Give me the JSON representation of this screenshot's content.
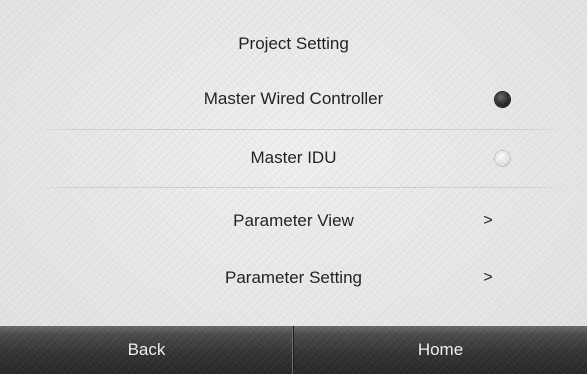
{
  "screen": {
    "title": "Project Setting"
  },
  "rows": [
    {
      "label": "Master Wired Controller",
      "control": "radio",
      "selected": true
    },
    {
      "label": "Master IDU",
      "control": "radio",
      "selected": false
    },
    {
      "label": "Parameter View",
      "control": "chevron",
      "chevron": ">"
    },
    {
      "label": "Parameter Setting",
      "control": "chevron",
      "chevron": ">"
    }
  ],
  "bottom_bar": {
    "back_label": "Back",
    "home_label": "Home"
  },
  "colors": {
    "background": "#ebebeb",
    "text": "#1e1e1e",
    "bar": "#333333",
    "bar_text": "#f2f2f2"
  },
  "icons": {
    "radio_selected": "radio-selected-icon",
    "radio_unselected": "radio-unselected-icon",
    "chevron": "chevron-right-icon"
  }
}
